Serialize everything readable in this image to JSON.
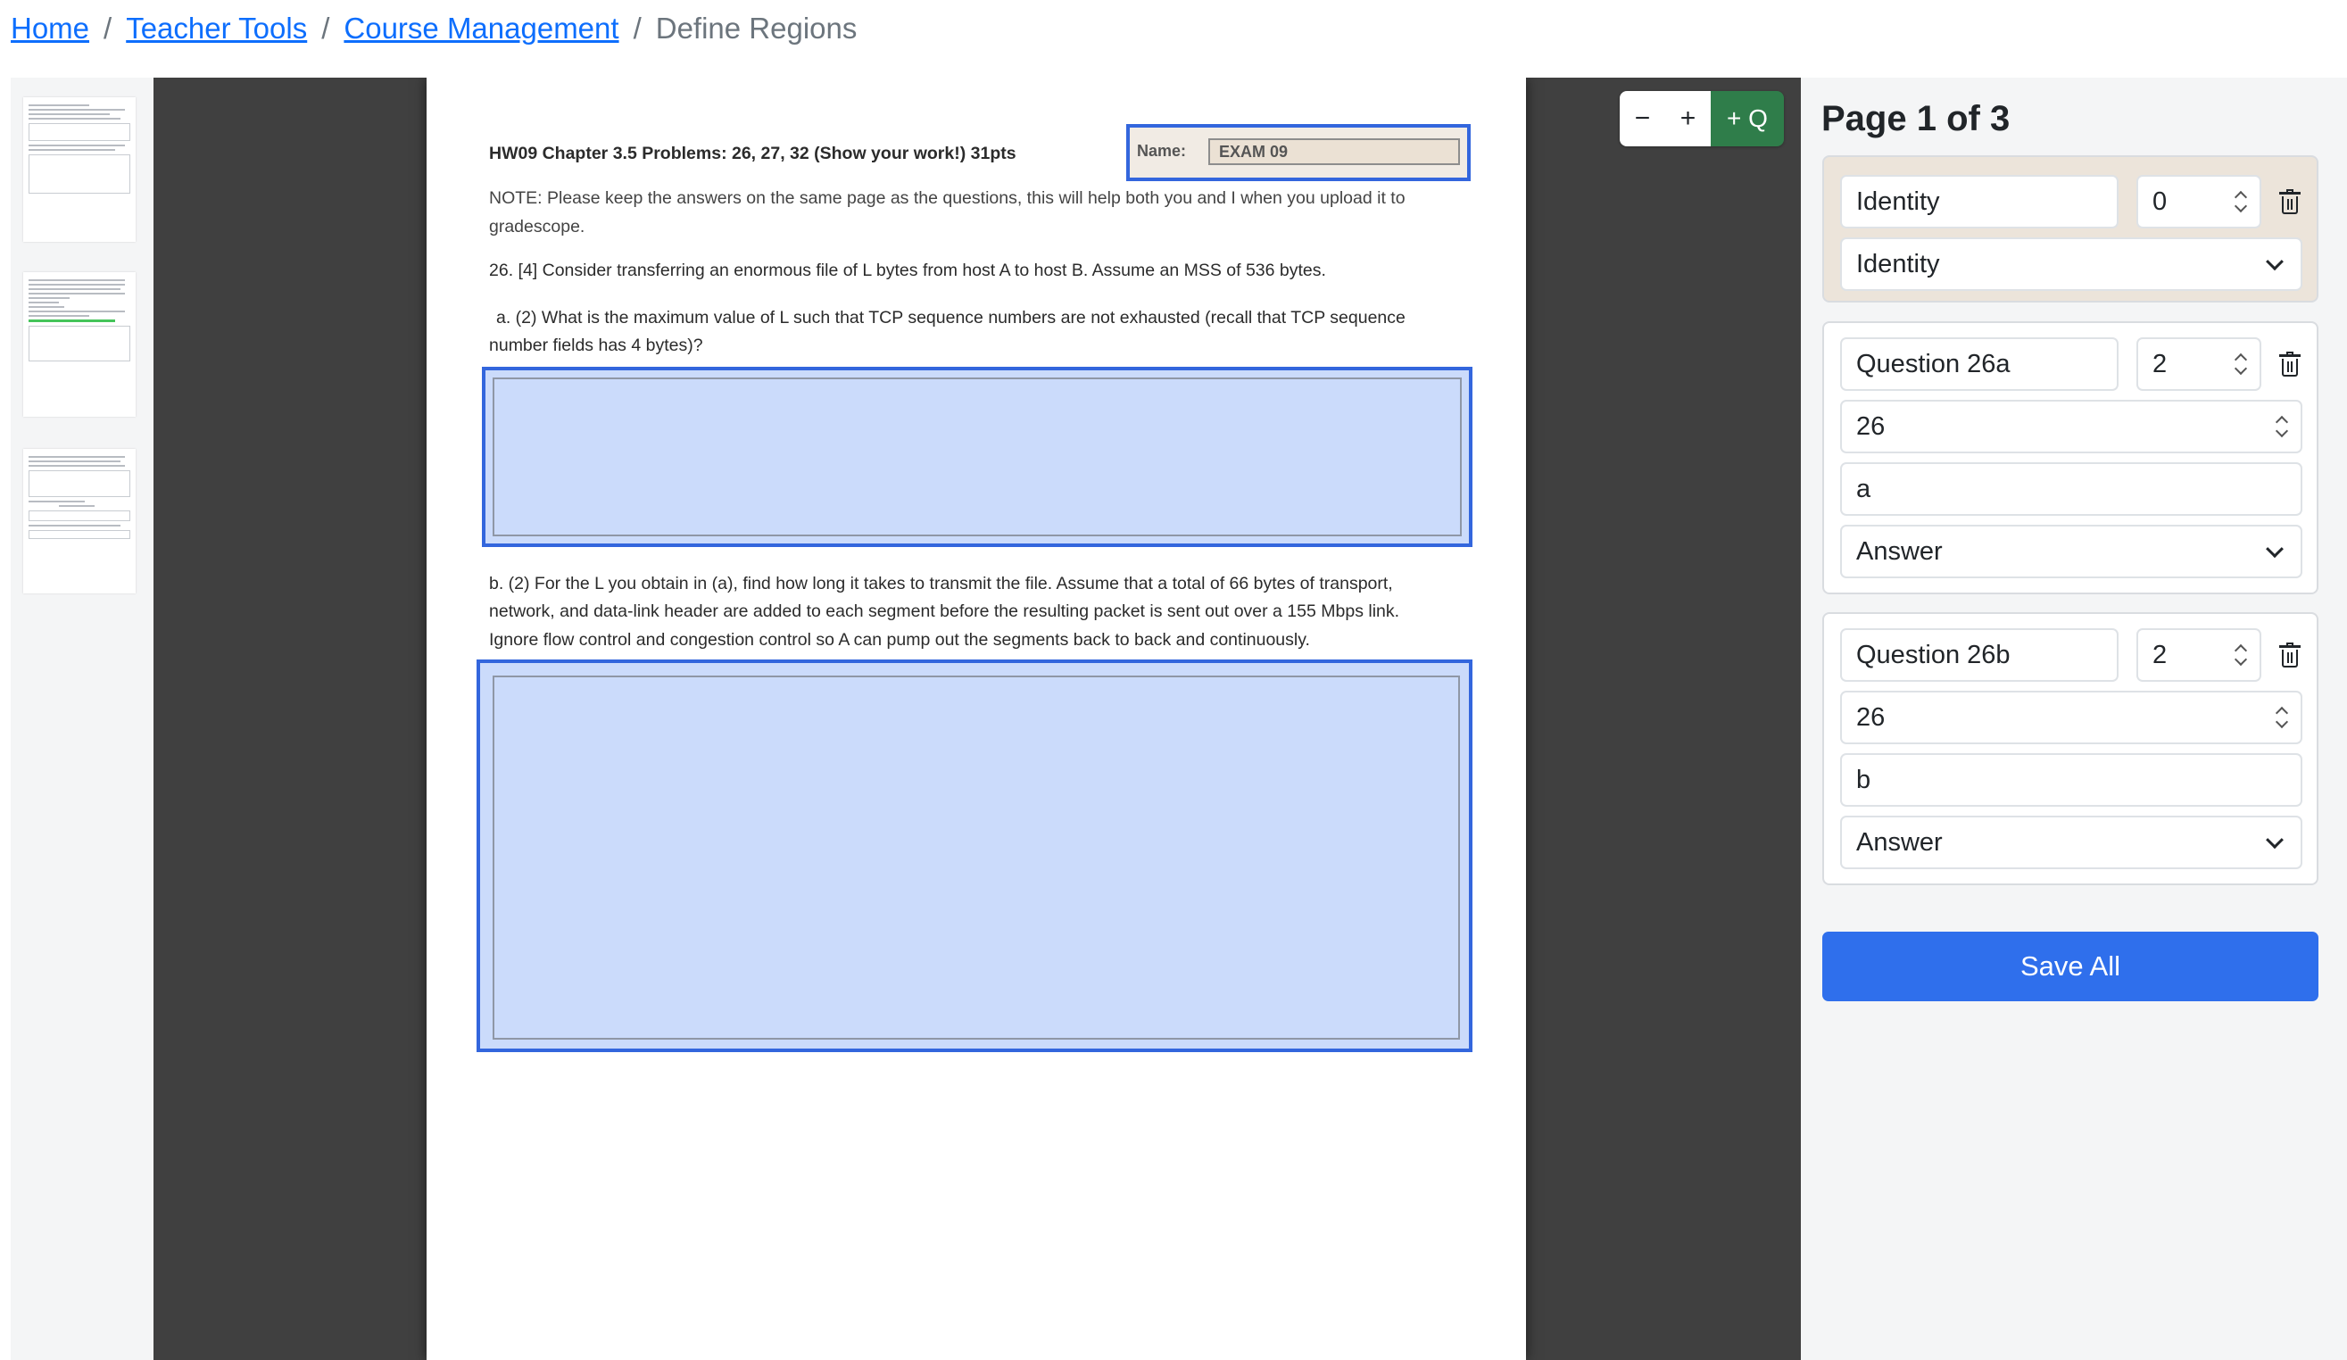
{
  "breadcrumb": {
    "items": [
      "Home",
      "Teacher Tools",
      "Course Management"
    ],
    "separator": "/",
    "current": "Define Regions"
  },
  "thumbnails": {
    "count": 3
  },
  "document": {
    "title": "HW09 Chapter 3.5 Problems: 26, 27, 32 (Show your work!) 31pts",
    "name_label": "Name:",
    "name_value": "EXAM 09",
    "note_line1": "NOTE: Please keep the answers on the same page as the questions, this will help both you and I when you upload it to",
    "note_line2": "gradescope.",
    "q26": "26. [4] Consider transferring an enormous file of L bytes from host A to host B. Assume an MSS of 536 bytes.",
    "q26a_line1": "a. (2) What is the maximum value of L such that TCP sequence numbers are not exhausted (recall that TCP sequence",
    "q26a_line2": "number fields has 4 bytes)?",
    "q26b_line1": "b. (2) For the L you obtain in (a), find how long it takes to transmit the file. Assume that a total of 66 bytes of transport,",
    "q26b_line2": "network, and data-link header are added to each segment before the resulting packet is sent out over a 155 Mbps link.",
    "q26b_line3": "Ignore flow control and congestion control so A can pump out the segments back to back and continuously."
  },
  "zoom_toolbar": {
    "zoom_out": "−",
    "zoom_in": "+",
    "add_question": "+ Q"
  },
  "panel": {
    "page_indicator": "Page 1 of 3",
    "regions": [
      {
        "label": "Identity",
        "points": "0",
        "type": "Identity"
      },
      {
        "label": "Question 26a",
        "points": "2",
        "question_number": "26",
        "part": "a",
        "type": "Answer"
      },
      {
        "label": "Question 26b",
        "points": "2",
        "question_number": "26",
        "part": "b",
        "type": "Answer"
      }
    ],
    "save_label": "Save All"
  },
  "colors": {
    "link": "#0d6efd",
    "region_border": "#3366dd",
    "region_fill": "#cbdbfb",
    "add_question_bg": "#2f7d4a",
    "save_bg": "#2f6fec",
    "identity_card_bg": "#ece4da"
  }
}
